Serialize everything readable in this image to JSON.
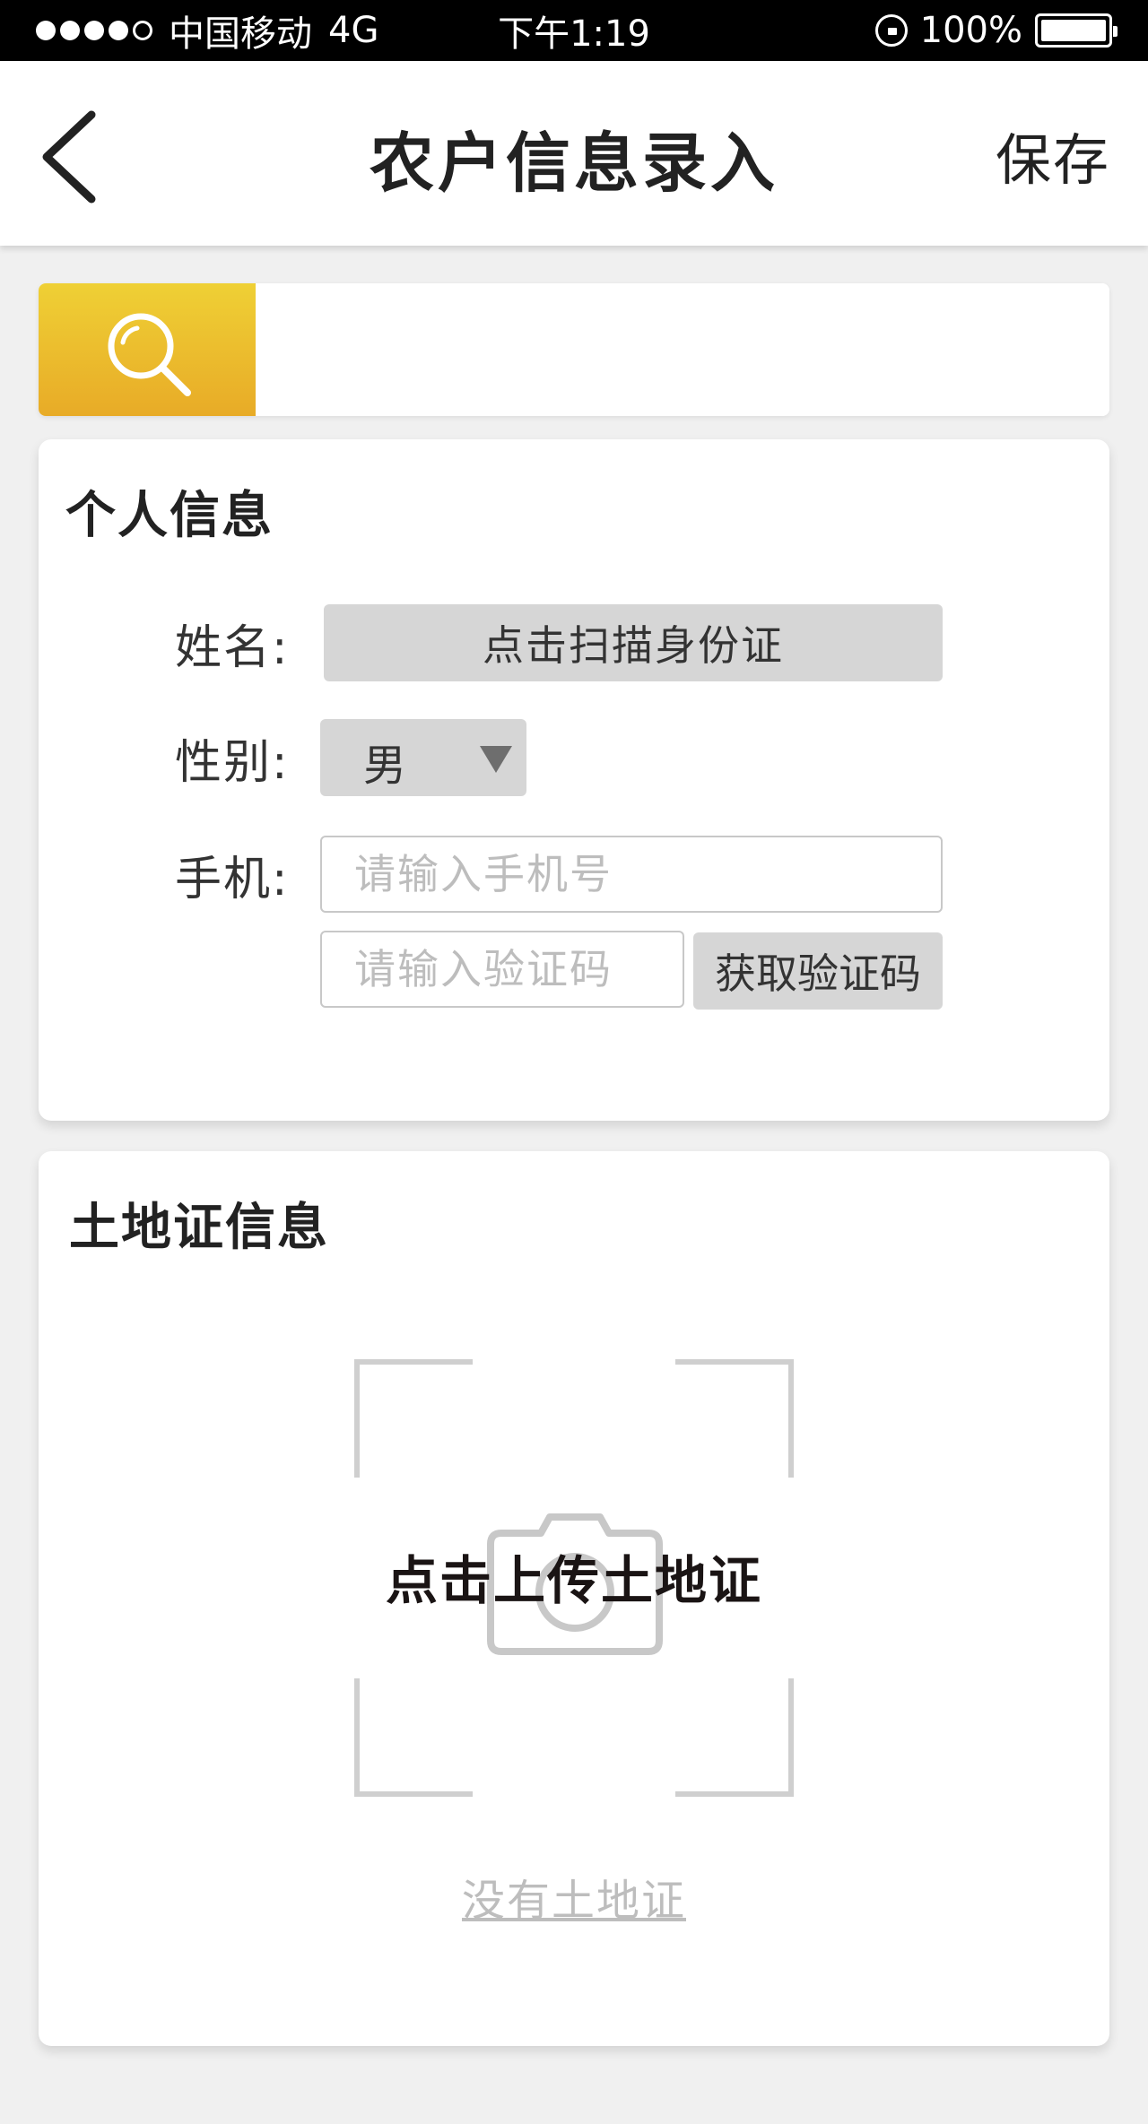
{
  "status_bar": {
    "carrier": "中国移动",
    "network": "4G",
    "time": "下午1:19",
    "battery_text": "100%",
    "signal_strength": 4,
    "signal_max": 5
  },
  "nav": {
    "title": "农户信息录入",
    "save_label": "保存"
  },
  "search": {
    "accent_color": "#e8ab27",
    "placeholder": "",
    "value": ""
  },
  "personal": {
    "section_title": "个人信息",
    "name_label": "姓名:",
    "scan_id_label": "点击扫描身份证",
    "gender_label": "性别:",
    "gender_value": "男",
    "phone_label": "手机:",
    "phone_placeholder": "请输入手机号",
    "code_placeholder": "请输入验证码",
    "get_code_label": "获取验证码"
  },
  "land": {
    "section_title": "土地证信息",
    "upload_label": "点击上传土地证",
    "no_certificate_label": "没有土地证"
  }
}
